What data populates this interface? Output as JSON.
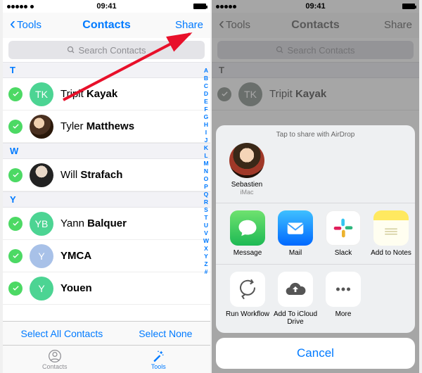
{
  "status": {
    "carrier": "",
    "time": "09:41"
  },
  "nav": {
    "back": "Tools",
    "title": "Contacts",
    "share": "Share"
  },
  "search": {
    "placeholder": "Search Contacts"
  },
  "sections": {
    "T": [
      {
        "first": "Tripit",
        "last": "Kayak",
        "avatar": "TK",
        "avclass": "tk"
      },
      {
        "first": "Tyler",
        "last": "Matthews",
        "avatar": "",
        "avclass": "img1"
      }
    ],
    "W": [
      {
        "first": "Will",
        "last": "Strafach",
        "avatar": "",
        "avclass": "img2"
      }
    ],
    "Y": [
      {
        "first": "Yann",
        "last": "Balquer",
        "avatar": "YB",
        "avclass": "yb"
      },
      {
        "first": "YMCA",
        "last": "",
        "avatar": "Y",
        "avclass": "y1"
      },
      {
        "first": "Youen",
        "last": "",
        "avatar": "Y",
        "avclass": "y2"
      }
    ]
  },
  "index_letters": "ABCDEFGHIJKLMNOPQRSTUVWXYZ#",
  "selectbar": {
    "all": "Select All Contacts",
    "none": "Select None"
  },
  "tabs": {
    "contacts": "Contacts",
    "tools": "Tools"
  },
  "sheet": {
    "airdrop_title": "Tap to share with AirDrop",
    "airdrop": {
      "name": "Sebastien",
      "device": "iMac"
    },
    "apps_row1": [
      {
        "label": "Message",
        "ic": "msg"
      },
      {
        "label": "Mail",
        "ic": "mail"
      },
      {
        "label": "Slack",
        "ic": "slack"
      },
      {
        "label": "Add to Notes",
        "ic": "notes"
      }
    ],
    "apps_row2": [
      {
        "label": "Run Workflow",
        "ic": "white"
      },
      {
        "label": "Add To iCloud Drive",
        "ic": "white"
      },
      {
        "label": "More",
        "ic": "white"
      }
    ],
    "cancel": "Cancel"
  }
}
